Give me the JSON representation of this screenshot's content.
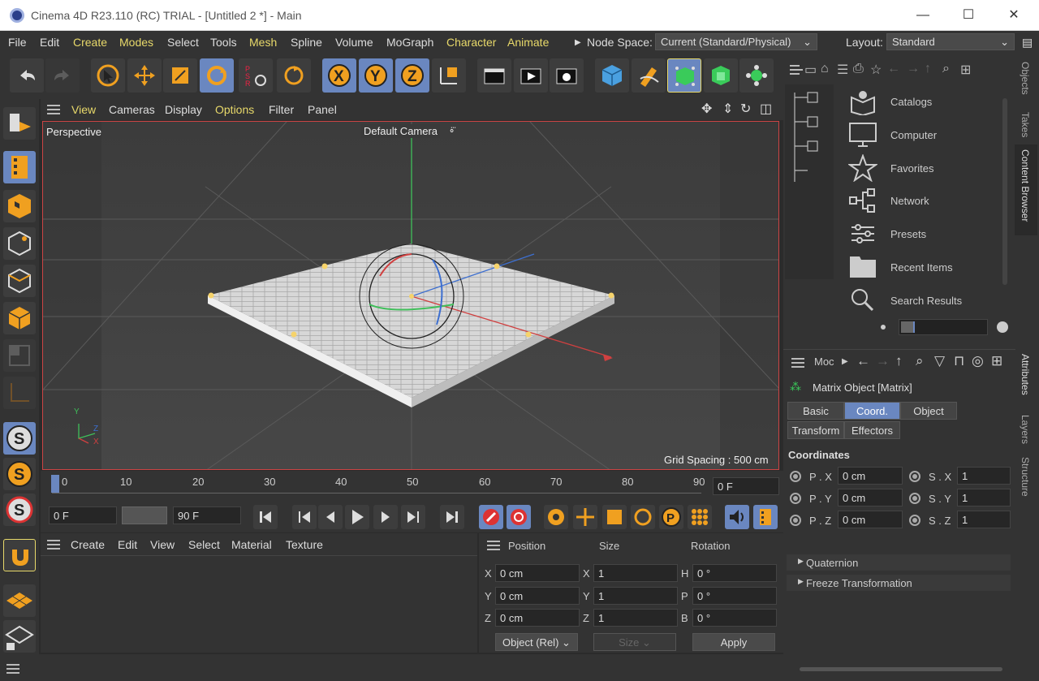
{
  "window": {
    "title": "Cinema 4D R23.110 (RC) TRIAL - [Untitled 2 *] - Main",
    "minimize": "—",
    "maximize": "☐",
    "close": "✕"
  },
  "menu": {
    "items": [
      "File",
      "Edit",
      "Create",
      "Modes",
      "Select",
      "Tools",
      "Mesh",
      "Spline",
      "Volume",
      "MoGraph",
      "Character",
      "Animate"
    ],
    "node_space_label": "Node Space:",
    "node_space_value": "Current (Standard/Physical)",
    "layout_label": "Layout:",
    "layout_value": "Standard"
  },
  "viewport_menu": {
    "items": [
      "View",
      "Cameras",
      "Display",
      "Options",
      "Filter",
      "Panel"
    ]
  },
  "viewport": {
    "name": "Perspective",
    "camera": "Default Camera",
    "grid_spacing": "Grid Spacing : 500 cm",
    "axis_y": "Y",
    "axis_z": "Z",
    "axis_x": "X"
  },
  "timeline": {
    "ticks": [
      "0",
      "10",
      "20",
      "30",
      "40",
      "50",
      "60",
      "70",
      "80",
      "90"
    ],
    "current_frame": "0 F"
  },
  "playback": {
    "start": "0 F",
    "end": "90 F"
  },
  "material_menu": {
    "items": [
      "Create",
      "Edit",
      "View",
      "Select",
      "Material",
      "Texture"
    ]
  },
  "coord_panel": {
    "headers": [
      "Position",
      "Size",
      "Rotation"
    ],
    "rows": [
      {
        "pl": "X",
        "pv": "0 cm",
        "sl": "X",
        "sv": "1",
        "rl": "H",
        "rv": "0 °"
      },
      {
        "pl": "Y",
        "pv": "0 cm",
        "sl": "Y",
        "sv": "1",
        "rl": "P",
        "rv": "0 °"
      },
      {
        "pl": "Z",
        "pv": "0 cm",
        "sl": "Z",
        "sv": "1",
        "rl": "B",
        "rv": "0 °"
      }
    ],
    "mode": "Object (Rel)",
    "size_mode": "Size",
    "apply": "Apply"
  },
  "content_browser": {
    "items": [
      "Catalogs",
      "Computer",
      "Favorites",
      "Network",
      "Presets",
      "Recent Items",
      "Search Results"
    ],
    "tab": "Content Browser"
  },
  "right_tabs": {
    "objects": "Objects",
    "takes": "Takes",
    "attributes": "Attributes",
    "layers": "Layers",
    "structure": "Structure"
  },
  "attributes": {
    "mode": "Moc",
    "object_name": "Matrix Object [Matrix]",
    "tabs": [
      "Basic",
      "Coord.",
      "Object",
      "Transform",
      "Effectors"
    ],
    "section": "Coordinates",
    "fields": [
      {
        "l": "P . X",
        "v": "0 cm",
        "sl": "S . X",
        "sv": "1"
      },
      {
        "l": "P . Y",
        "v": "0 cm",
        "sl": "S . Y",
        "sv": "1"
      },
      {
        "l": "P . Z",
        "v": "0 cm",
        "sl": "S . Z",
        "sv": "1"
      }
    ],
    "quaternion": "Quaternion",
    "freeze": "Freeze Transformation"
  },
  "colors": {
    "accent": "#6a87c0",
    "menu_yellow": "#e8d96a",
    "viewport_border": "#cc4444"
  }
}
